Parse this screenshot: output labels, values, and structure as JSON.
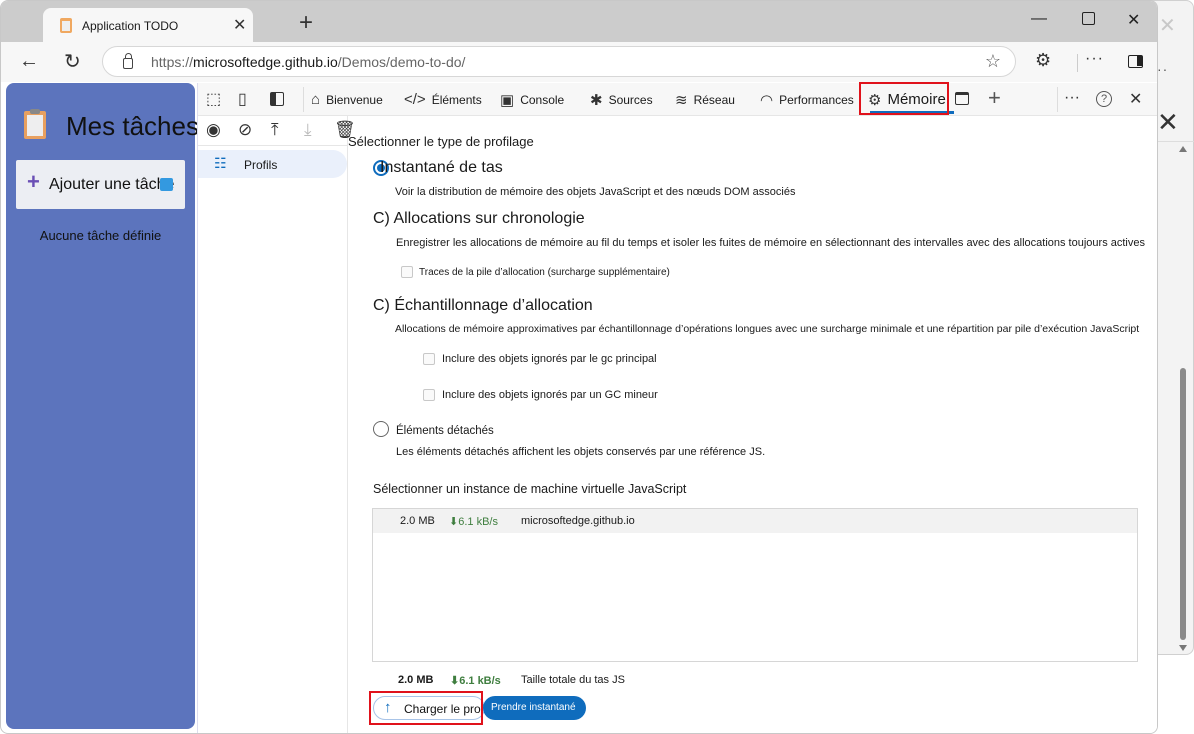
{
  "browser": {
    "tab_title": "Application TODO",
    "url_prefix": "https://",
    "url_domain": "microsoftedge.github.io",
    "url_path": "/Demos/demo-to-do/"
  },
  "app": {
    "title": "Mes tâches",
    "add_task_label": "Ajouter une tâche",
    "empty_label": "Aucune tâche définie",
    "accent_color": "#5c74bd"
  },
  "devtools": {
    "tabs": [
      {
        "label": "Bienvenue",
        "icon": "home-icon"
      },
      {
        "label": "Éléments",
        "icon": "code-icon"
      },
      {
        "label": "Console",
        "icon": "console-icon"
      },
      {
        "label": "Sources",
        "icon": "bug-icon"
      },
      {
        "label": "Réseau",
        "icon": "wifi-icon"
      },
      {
        "label": "Performances",
        "icon": "gauge-icon"
      },
      {
        "label": "Mémoire",
        "icon": "chip-icon",
        "active": true
      }
    ],
    "sidebar_item": "Profils",
    "select_type_heading": "Sélectionner le type de profilage",
    "options": [
      {
        "title": "Instantané de tas",
        "description": "Voir la distribution de mémoire des objets JavaScript et des nœuds DOM associés",
        "selected": true
      },
      {
        "title": "C) Allocations sur chronologie",
        "description": "Enregistrer les allocations de mémoire au fil du temps et isoler les fuites de mémoire en sélectionnant des intervalles avec des allocations toujours actives",
        "checkboxes": [
          "Traces de la pile d’allocation (surcharge supplémentaire)"
        ]
      },
      {
        "title": "C) Échantillonnage d’allocation",
        "description": "Allocations de mémoire approximatives par échantillonnage d’opérations longues avec une surcharge minimale et une répartition par pile d’exécution JavaScript",
        "checkboxes": [
          "Inclure des objets ignorés par le gc principal",
          "Inclure des objets ignorés par un GC mineur"
        ]
      },
      {
        "title": "Éléments détachés",
        "description": "Les éléments détachés affichent les objets conservés par une référence JS.",
        "selected": false
      }
    ],
    "vm_heading": "Sélectionner un instance de machine virtuelle JavaScript",
    "vm_instances": [
      {
        "size": "2.0 MB",
        "rate": "⬇6.1 kB/s",
        "name": "microsoftedge.github.io"
      }
    ],
    "total": {
      "size": "2.0 MB",
      "rate": "⬇6.1 kB/s",
      "label": "Taille totale du tas JS"
    },
    "load_button": "Charger le profil",
    "snapshot_button": "Prendre instantané"
  }
}
